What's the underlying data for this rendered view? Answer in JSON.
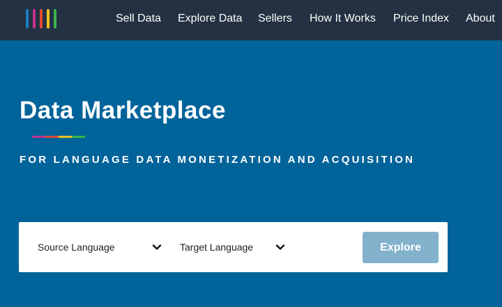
{
  "nav": {
    "logo_icon": "bar-logo-icon",
    "logo_colors": [
      "#1a7dc4",
      "#c2338f",
      "#e04a33",
      "#f2c320",
      "#3ab54a"
    ],
    "links": [
      "Sell Data",
      "Explore Data",
      "Sellers",
      "How It Works",
      "Price Index",
      "About"
    ]
  },
  "hero": {
    "title": "Data Marketplace",
    "underline_colors": [
      "#c2338f",
      "#e04a33",
      "#f2c320",
      "#3ab54a"
    ],
    "subtitle": "FOR LANGUAGE DATA MONETIZATION AND ACQUISITION"
  },
  "search": {
    "source_label": "Source Language",
    "target_label": "Target Language",
    "chevron_icon": "chevron-down-icon",
    "explore_label": "Explore"
  },
  "colors": {
    "nav_background": "#233142",
    "hero_background": "#00639a",
    "button_disabled": "#82b2cc"
  }
}
